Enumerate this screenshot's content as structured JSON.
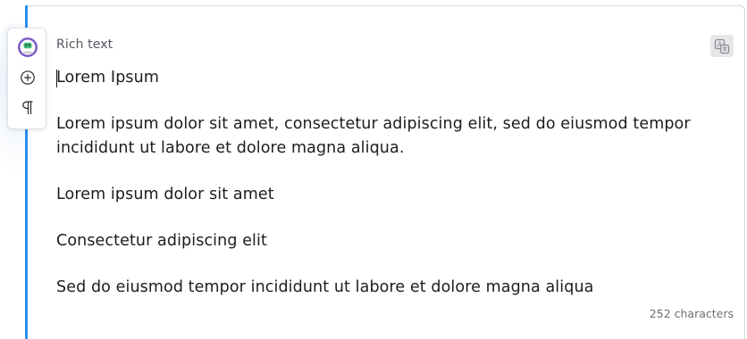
{
  "field": {
    "label": "Rich text",
    "translate_icon": "translate-icon"
  },
  "side_toolbar": {
    "avatar_icon": "user-avatar-icon",
    "add_icon": "plus-circle-icon",
    "paragraph_icon": "pilcrow-icon"
  },
  "editor": {
    "paragraphs": [
      "Lorem Ipsum",
      "Lorem ipsum dolor sit amet, consectetur adipiscing elit, sed do eiusmod tempor incididunt ut labore et dolore magna aliqua.",
      "Lorem ipsum dolor sit amet",
      "Consectetur adipiscing elit",
      "Sed do eiusmod tempor incididunt ut labore et dolore magna aliqua"
    ]
  },
  "footer": {
    "char_count": "252 characters"
  },
  "colors": {
    "accent": "#2b8ff0",
    "avatar": "#7b5cc4",
    "avatar_face": "#3fbf7f"
  }
}
